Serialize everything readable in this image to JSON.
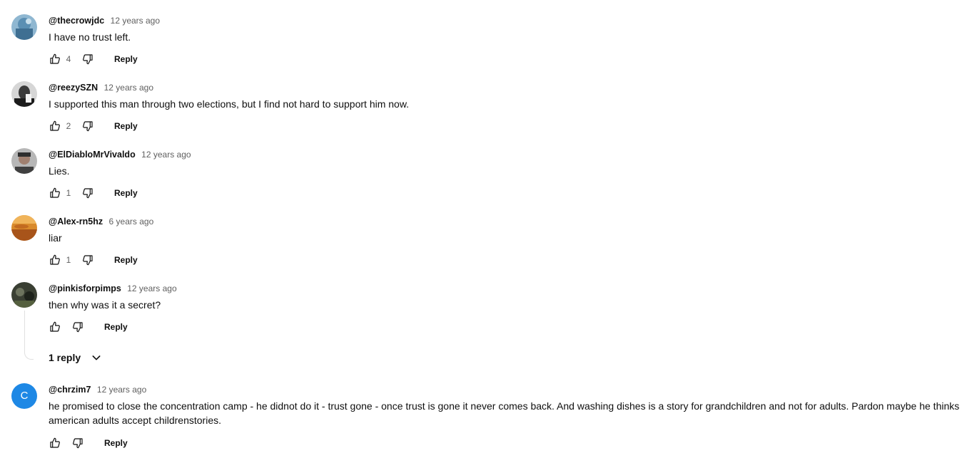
{
  "comments": [
    {
      "author": "@thecrowjdc",
      "time": "12 years ago",
      "text": "I have no trust left.",
      "likes": "4",
      "reply_label": "Reply"
    },
    {
      "author": "@reezySZN",
      "time": "12 years ago",
      "text": "I supported this man through two elections, but I find not hard to support him now.",
      "likes": "2",
      "reply_label": "Reply"
    },
    {
      "author": "@ElDiabloMrVivaldo",
      "time": "12 years ago",
      "text": "Lies.",
      "likes": "1",
      "reply_label": "Reply"
    },
    {
      "author": "@Alex-rn5hz",
      "time": "6 years ago",
      "text": "liar",
      "likes": "1",
      "reply_label": "Reply"
    },
    {
      "author": "@pinkisforpimps",
      "time": "12 years ago",
      "text": "then why was it a secret?",
      "likes": "",
      "reply_label": "Reply",
      "replies_label": "1 reply"
    },
    {
      "author": "@chrzim7",
      "avatar_letter": "C",
      "time": "12 years ago",
      "text": "he promised to close the concentration camp - he didnot do it - trust gone -  once trust is gone it never comes back. And washing dishes is a story for grandchildren and not for adults. Pardon maybe he thinks american adults accept childrenstories.",
      "likes": "",
      "reply_label": "Reply"
    }
  ],
  "colors": {
    "text": "#0f0f0f",
    "secondary": "#606060",
    "letter_avatar_bg": "#1e88e5"
  },
  "icons": {
    "like": "thumb-up-icon",
    "dislike": "thumb-down-icon",
    "expand": "chevron-down-icon"
  }
}
